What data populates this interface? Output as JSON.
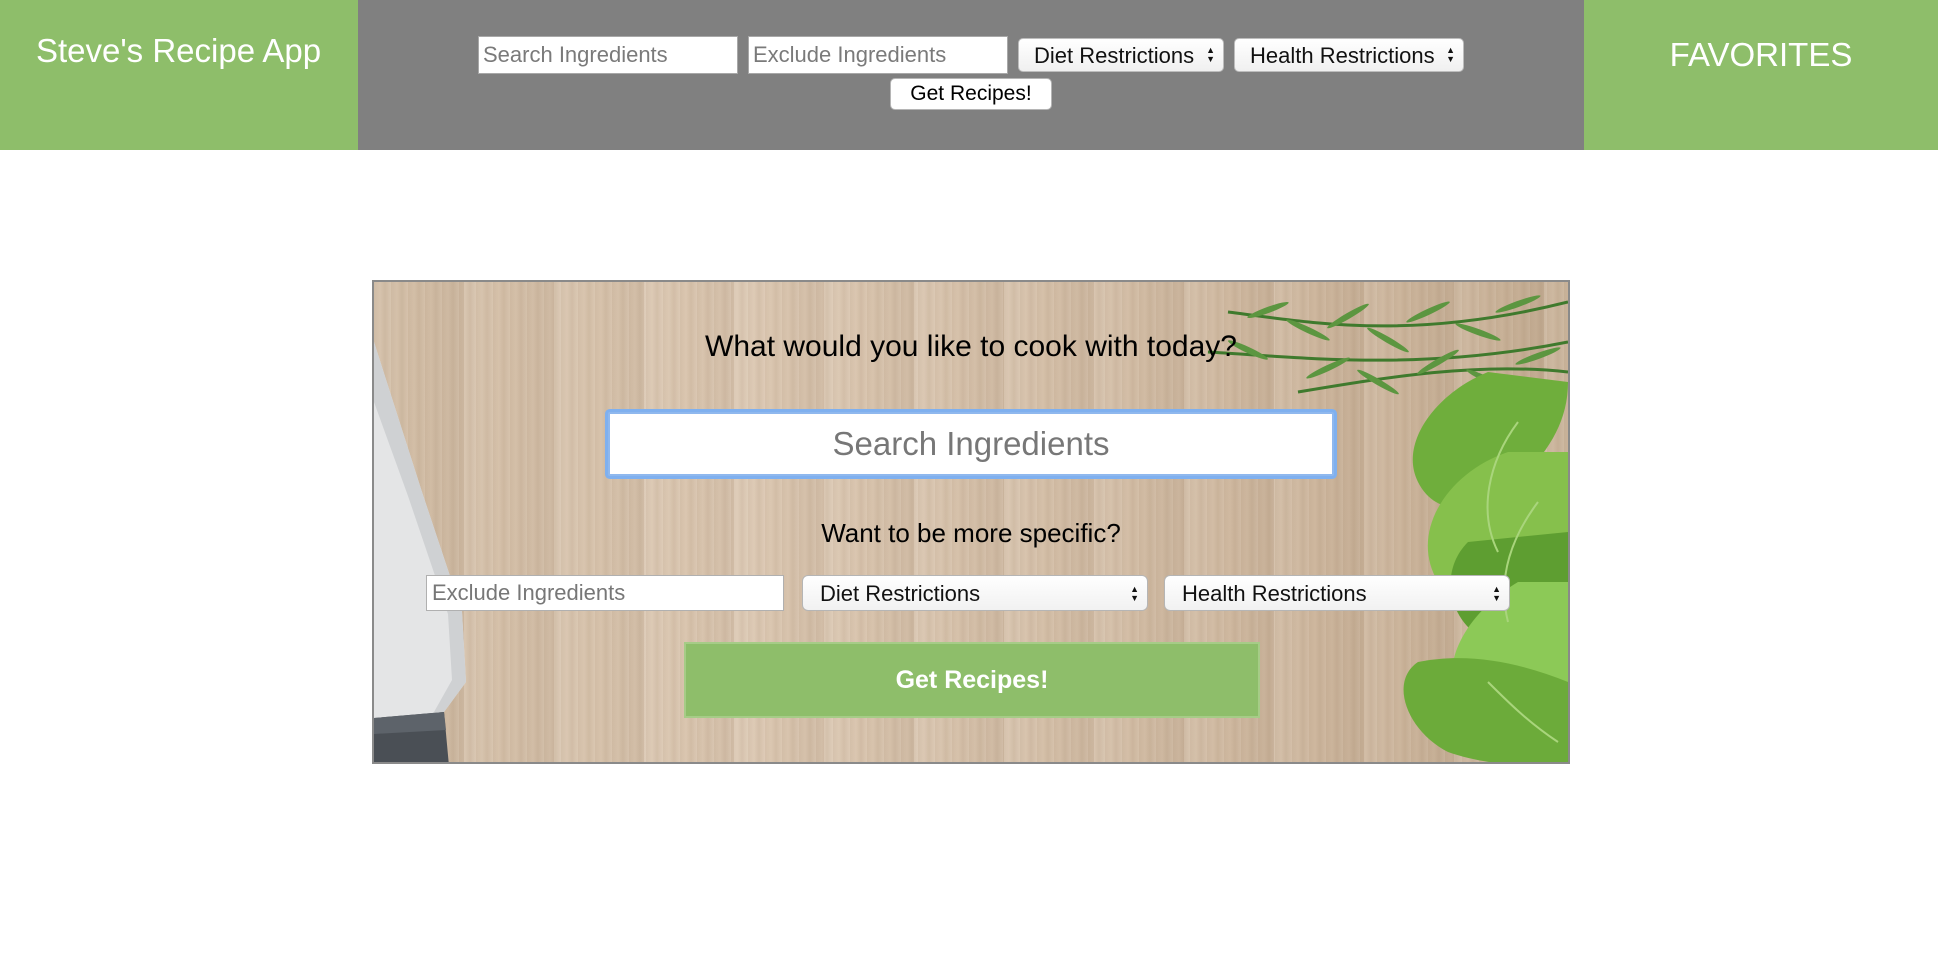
{
  "header": {
    "brand": "Steve's Recipe App",
    "favorites_label": "FAVORITES",
    "search_placeholder": "Search Ingredients",
    "exclude_placeholder": "Exclude Ingredients",
    "diet_select": "Diet Restrictions",
    "health_select": "Health Restrictions",
    "submit_label": "Get Recipes!"
  },
  "hero": {
    "title": "What would you like to cook with today?",
    "search_placeholder": "Search Ingredients",
    "subtitle": "Want to be more specific?",
    "exclude_placeholder": "Exclude Ingredients",
    "diet_select": "Diet Restrictions",
    "health_select": "Health Restrictions",
    "submit_label": "Get Recipes!"
  },
  "icons": {
    "select_arrows": "up-down-chevron-icon"
  },
  "colors": {
    "accent_green": "#8ebe6a",
    "topbar_gray": "#808080",
    "focus_blue": "#7fb0ef"
  }
}
